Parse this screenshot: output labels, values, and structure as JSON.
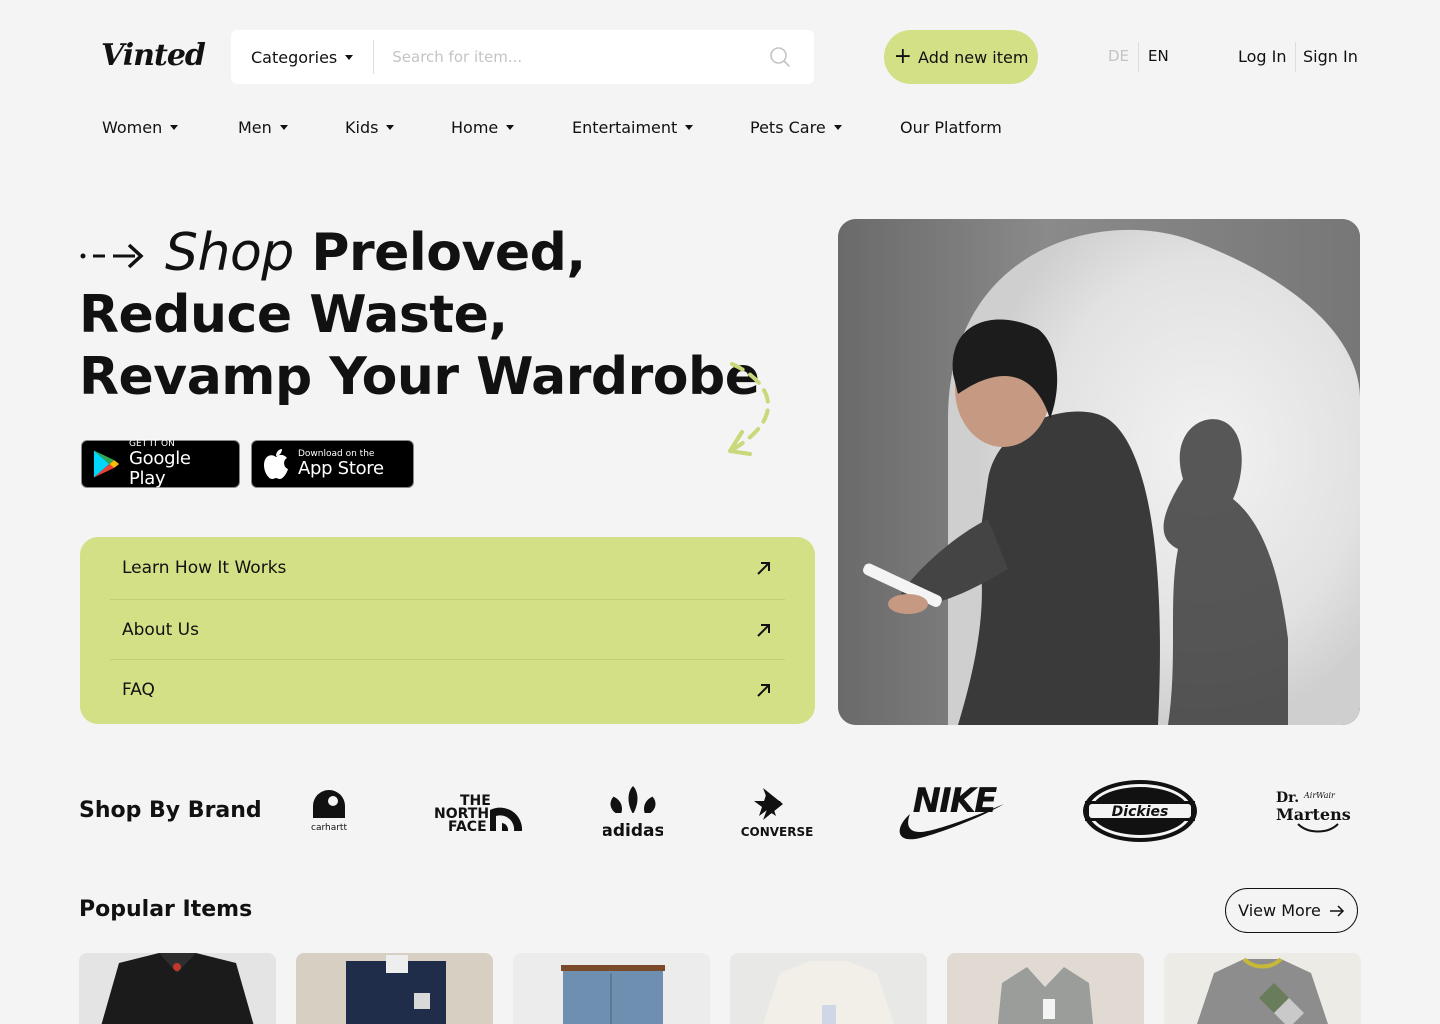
{
  "header": {
    "logo": "Vinted",
    "categories_label": "Categories",
    "search_placeholder": "Search for item...",
    "add_item_label": "Add new item",
    "languages": [
      "DE",
      "EN"
    ],
    "active_language": "EN",
    "login_label": "Log In",
    "signin_label": "Sign In"
  },
  "nav": {
    "items": [
      {
        "label": "Women",
        "has_dropdown": true
      },
      {
        "label": "Men",
        "has_dropdown": true
      },
      {
        "label": "Kids",
        "has_dropdown": true
      },
      {
        "label": "Home",
        "has_dropdown": true
      },
      {
        "label": "Entertaiment",
        "has_dropdown": true
      },
      {
        "label": "Pets Care",
        "has_dropdown": true
      },
      {
        "label": "Our Platform",
        "has_dropdown": false
      }
    ]
  },
  "hero": {
    "title_italic": "Shop",
    "title_line1_rest": "Preloved,",
    "title_line2": "Reduce Waste,",
    "title_line3": "Revamp Your Wardrobe",
    "google_play_small": "GET IT ON",
    "google_play_big": "Google Play",
    "app_store_small": "Download on the",
    "app_store_big": "App Store",
    "links": [
      {
        "label": "Learn How It Works"
      },
      {
        "label": "About Us"
      },
      {
        "label": "FAQ"
      }
    ]
  },
  "brands": {
    "title": "Shop By Brand",
    "items": [
      "carhartt",
      "THE NORTH FACE",
      "adidas",
      "CONVERSE",
      "NIKE",
      "Dickies",
      "Dr. AirWair Martens"
    ]
  },
  "popular": {
    "title": "Popular Items",
    "view_more_label": "View More"
  },
  "colors": {
    "accent": "#d3e085",
    "background": "#f4f4f4",
    "text": "#111111"
  }
}
